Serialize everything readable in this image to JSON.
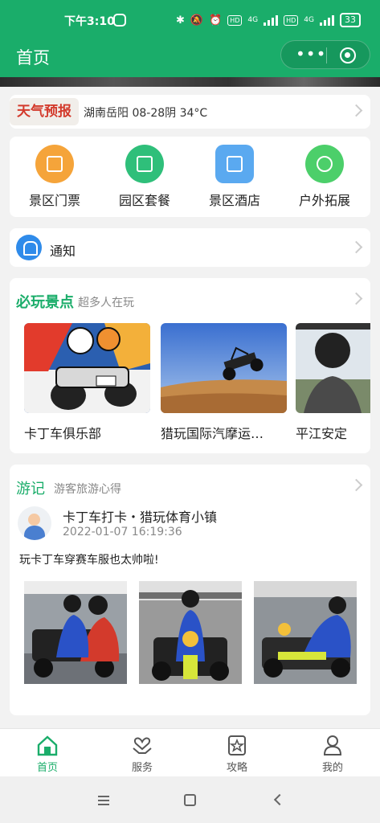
{
  "status_bar": {
    "time": "下午3:10",
    "network_a": "4G",
    "network_b": "4G",
    "hd": "HD",
    "battery": "33"
  },
  "header": {
    "title": "首页",
    "capsule_more": "•••"
  },
  "weather": {
    "tag": "天气预报",
    "info": "湖南岳阳 08-28阴 34°C"
  },
  "categories": [
    {
      "label": "景区门票",
      "icon": "ticket-icon",
      "color": "#f5a43a"
    },
    {
      "label": "园区套餐",
      "icon": "package-icon",
      "color": "#2fbf7a"
    },
    {
      "label": "景区酒店",
      "icon": "hotel-icon",
      "color": "#5aa9f0"
    },
    {
      "label": "户外拓展",
      "icon": "outdoor-icon",
      "color": "#4ccf6a"
    }
  ],
  "notice": {
    "label": "通知"
  },
  "attractions": {
    "title": "必玩景点",
    "subtitle": "超多人在玩",
    "items": [
      {
        "name": "卡丁车俱乐部"
      },
      {
        "name": "猎玩国际汽摩运…"
      },
      {
        "name": "平江安定"
      }
    ]
  },
  "notes": {
    "title": "游记",
    "subtitle": "游客旅游心得",
    "post": {
      "title": "卡丁车打卡・猎玩体育小镇",
      "time": "2022-01-07 16:19:36",
      "text": "玩卡丁车穿赛车服也太帅啦!"
    }
  },
  "tabs": [
    {
      "label": "首页",
      "icon": "home-icon",
      "active": true
    },
    {
      "label": "服务",
      "icon": "service-icon",
      "active": false
    },
    {
      "label": "攻略",
      "icon": "guide-icon",
      "active": false
    },
    {
      "label": "我的",
      "icon": "profile-icon",
      "active": false
    }
  ],
  "colors": {
    "brand_green": "#1aad6a",
    "weather_red": "#d33a2c"
  }
}
